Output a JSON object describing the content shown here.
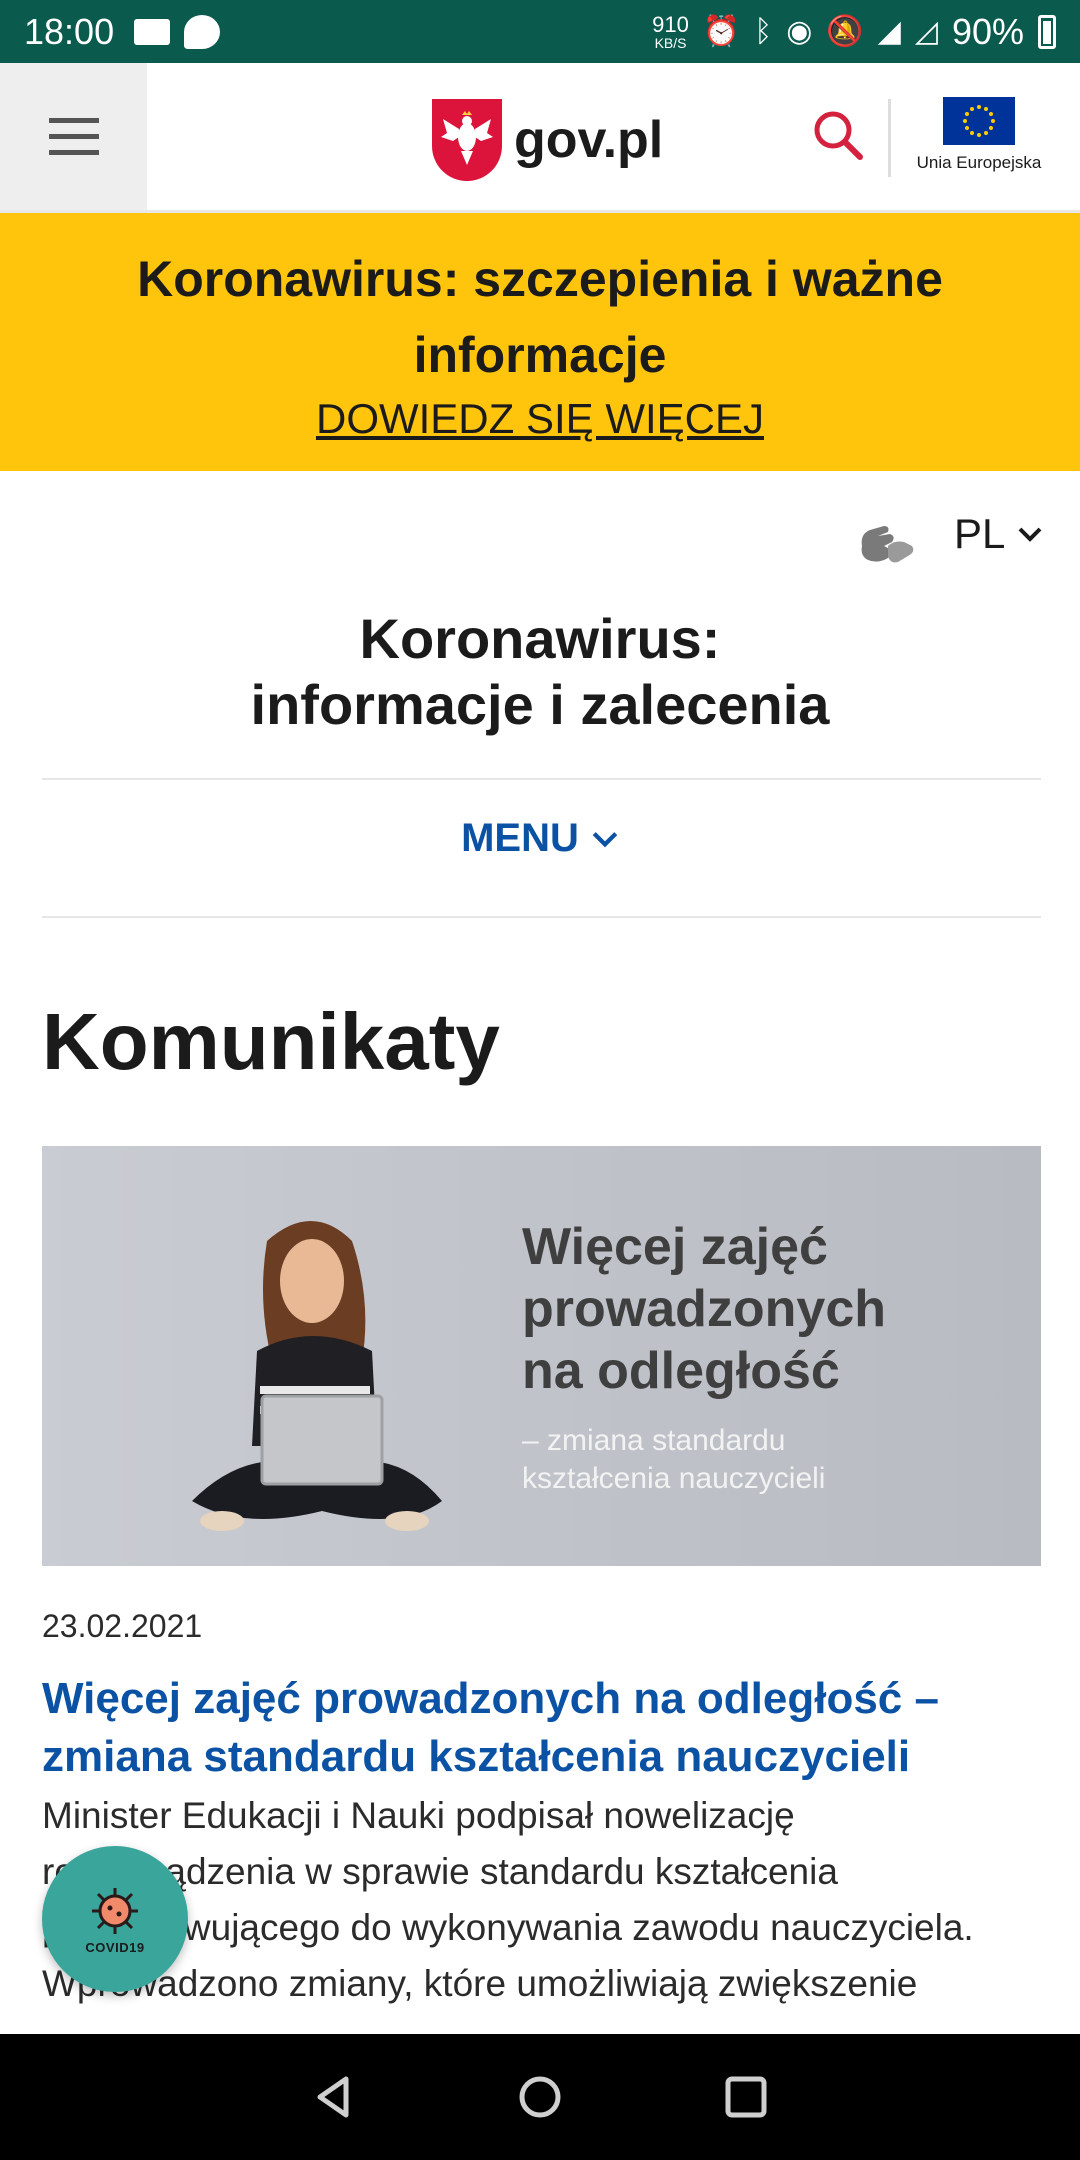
{
  "status_bar": {
    "time": "18:00",
    "net_speed_value": "910",
    "net_speed_unit": "KB/S",
    "network_type": "LTE",
    "battery": "90%"
  },
  "header": {
    "logo_text": "gov.pl",
    "eu_label": "Unia Europejska"
  },
  "banner": {
    "title": "Koronawirus: szczepienia i ważne informacje",
    "link": "DOWIEDZ SIĘ WIĘCEJ"
  },
  "language": {
    "selected": "PL"
  },
  "site": {
    "title_line1": "Koronawirus:",
    "title_line2": "informacje i zalecenia",
    "menu_label": "MENU"
  },
  "page": {
    "heading": "Komunikaty"
  },
  "article": {
    "image_title_line1": "Więcej zajęć",
    "image_title_line2": "prowadzonych",
    "image_title_line3": "na odległość",
    "image_sub_line1": "– zmiana standardu",
    "image_sub_line2": "kształcenia nauczycieli",
    "date": "23.02.2021",
    "title": "Więcej zajęć prowadzonych na odległość – zmiana standardu kształcenia nauczycieli",
    "body": "Minister Edukacji i Nauki podpisał nowelizację rozporządzenia w sprawie standardu kształcenia przygotowującego do wykonywania zawodu nauczyciela. Wprowadzono zmiany, które umożliwiają zwiększenie"
  },
  "fab": {
    "label": "COVID19"
  },
  "colors": {
    "status_bar": "#0a5a4e",
    "banner": "#ffc40c",
    "link_blue": "#0b52a4",
    "brand_red": "#dc143c",
    "fab": "#3aa59b"
  }
}
